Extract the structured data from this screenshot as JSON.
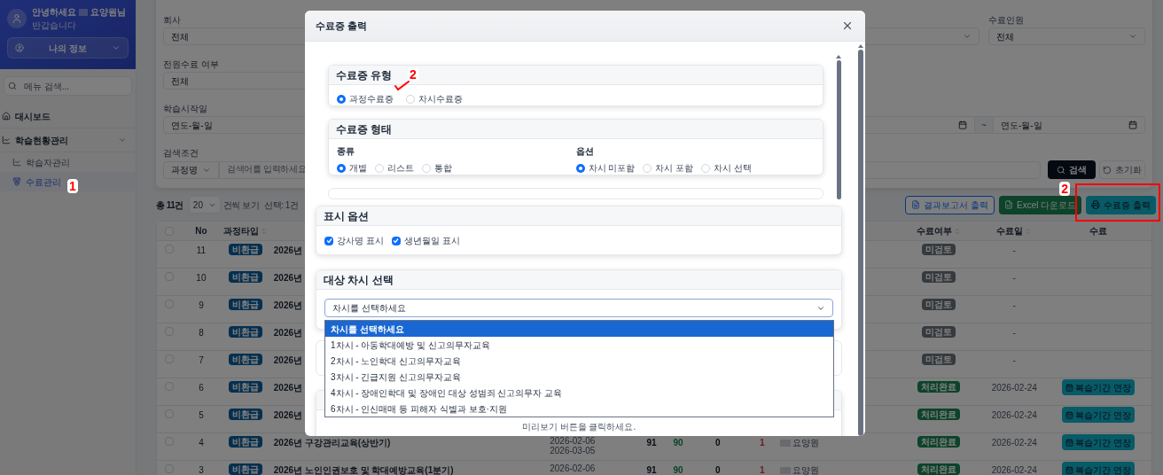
{
  "sidebar": {
    "greeting": "안녕하세요",
    "user_name": "요양원님",
    "welcome": "반갑습니다",
    "profile_button": "나의 정보",
    "search_placeholder": "메뉴 검색...",
    "menu": [
      {
        "label": "대시보드",
        "selected": false
      },
      {
        "label": "학습현황관리",
        "selected": false,
        "expanded": true,
        "children": [
          {
            "label": "학습자관리",
            "selected": false
          },
          {
            "label": "수료관리",
            "selected": true,
            "annotation": "1"
          }
        ]
      }
    ]
  },
  "filters": {
    "company": {
      "label": "회사",
      "value": "전체"
    },
    "completion_count": {
      "label": "수료인원",
      "value": "전체"
    },
    "all_completed": {
      "label": "전원수료 여부",
      "value": "전체"
    },
    "start_date": {
      "label": "학습시작일",
      "from": "연도-월-일",
      "separator": "~",
      "to": "연도-월-일"
    },
    "search": {
      "label": "검색조건",
      "field": "과정명",
      "placeholder": "검색어를 입력하세요"
    },
    "search_button": "검색",
    "reset_button": "초기화"
  },
  "toolbar": {
    "total": "총 11건",
    "page_size": "20",
    "page_size_suffix": "건씩 보기",
    "selected_count": "선택: 1건",
    "buttons": [
      {
        "label": "결과보고서 출력",
        "kind": "report"
      },
      {
        "label": "Excel 다운로드",
        "kind": "excel"
      },
      {
        "label": "수료증 출력",
        "kind": "print",
        "annotation": "2"
      }
    ]
  },
  "table": {
    "select_all_checked": false,
    "columns": {
      "no": "No",
      "type": "과정타입",
      "status": "수료여부",
      "date": "수료일",
      "action": "수료"
    },
    "rows": [
      {
        "checked": false,
        "no": "11",
        "type": "비환급",
        "course": "2026년",
        "status": "미검토",
        "kind": "pending",
        "date": "-"
      },
      {
        "checked": false,
        "no": "10",
        "type": "비환급",
        "course": "2026년",
        "status": "미검토",
        "kind": "pending",
        "date": "-"
      },
      {
        "checked": false,
        "no": "9",
        "type": "비환급",
        "course": "2026년",
        "status": "미검토",
        "kind": "pending",
        "date": "-"
      },
      {
        "checked": false,
        "no": "8",
        "type": "비환급",
        "course": "2026년",
        "status": "미검토",
        "kind": "pending",
        "date": "-"
      },
      {
        "checked": false,
        "no": "7",
        "type": "비환급",
        "course": "2026년",
        "status": "미검토",
        "kind": "pending",
        "date": "-"
      },
      {
        "checked": false,
        "no": "6",
        "type": "비환급",
        "course": "2026년",
        "status": "처리완료",
        "kind": "done",
        "date": "2026-02-24",
        "action": "복습기간 연장"
      },
      {
        "checked": false,
        "no": "5",
        "type": "비환급",
        "course": "2026년",
        "status": "처리완료",
        "kind": "done",
        "date": "2026-02-24",
        "action": "복습기간 연장"
      },
      {
        "checked": false,
        "no": "4",
        "type": "비환급",
        "course": "2026년 구강관리교육(상반기)",
        "period": [
          "2026-02-06",
          "2026-03-05"
        ],
        "counts": [
          "91",
          "90",
          "0",
          "1"
        ],
        "learner": "요양원",
        "status": "처리완료",
        "kind": "done",
        "date": "2026-02-24",
        "action": "복습기간 연장"
      },
      {
        "checked": false,
        "no": "3",
        "type": "비환급",
        "course": "2026년 노인인권보호 및 학대예방교육(1분기)",
        "period": [
          "2026-02-06"
        ],
        "counts": [
          "91",
          "90",
          "0",
          "1"
        ],
        "learner": "요양원",
        "status": "처리완료",
        "kind": "done",
        "date": "2026-02-24",
        "action": "복습기간 연장"
      }
    ]
  },
  "modal": {
    "title": "수료증 출력",
    "type_section": {
      "title": "수료증 유형",
      "options": [
        {
          "label": "과정수료증",
          "selected": true
        },
        {
          "label": "차시수료증",
          "selected": false,
          "annotation": "2"
        }
      ]
    },
    "format_section": {
      "title": "수료증 형태",
      "groups": [
        {
          "label": "종류",
          "options": [
            {
              "label": "개별",
              "selected": true
            },
            {
              "label": "리스트",
              "selected": false
            },
            {
              "label": "통합",
              "selected": false
            }
          ]
        },
        {
          "label": "옵션",
          "options": [
            {
              "label": "차시 미포함",
              "selected": true
            },
            {
              "label": "차시 포함",
              "selected": false
            },
            {
              "label": "차시 선택",
              "selected": false
            }
          ]
        }
      ]
    },
    "display_section": {
      "title": "표시 옵션",
      "options": [
        {
          "label": "강사명 표시",
          "checked": true
        },
        {
          "label": "생년월일 표시",
          "checked": true
        }
      ]
    },
    "session_section": {
      "title": "대상 차시 선택",
      "value": "차시를 선택하세요",
      "dropdown": [
        {
          "label": "차시를 선택하세요",
          "selected": true
        },
        {
          "label": "1차시 - 아동학대예방 및 신고의무자교육",
          "selected": false
        },
        {
          "label": "2차시 - 노인학대 신고의무자교육",
          "selected": false
        },
        {
          "label": "3차시 - 긴급지원 신고의무자교육",
          "selected": false
        },
        {
          "label": "4차시 - 장애인학대 및 장애인 대상 성범죄 신고의무자 교육",
          "selected": false
        },
        {
          "label": "6차시 - 인신매매 등 피해자 식별과 보호·지원",
          "selected": false
        }
      ]
    },
    "preview_text": "미리보기 버튼을 클릭하세요."
  }
}
